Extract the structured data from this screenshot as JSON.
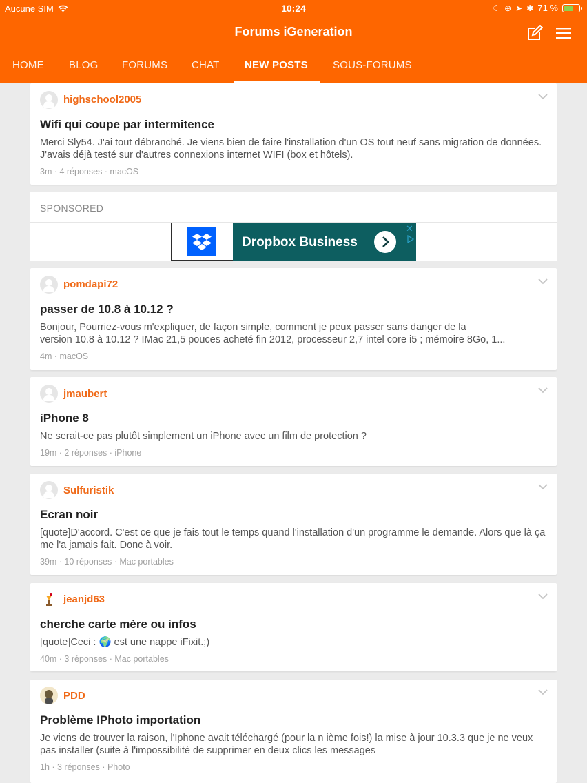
{
  "status_bar": {
    "carrier": "Aucune SIM",
    "time": "10:24",
    "battery": "71 %",
    "battery_level": 0.71
  },
  "header": {
    "title": "Forums iGeneration",
    "compose_icon": "compose-icon",
    "menu_icon": "hamburger-menu-icon",
    "accent_color": "#fe6600"
  },
  "tabs": [
    {
      "label": "HOME"
    },
    {
      "label": "BLOG"
    },
    {
      "label": "FORUMS"
    },
    {
      "label": "CHAT"
    },
    {
      "label": "NEW POSTS",
      "active": true
    },
    {
      "label": "SOUS-FORUMS"
    }
  ],
  "sponsored": {
    "label": "SPONSORED",
    "ad_text": "Dropbox Business",
    "ad_close": "✕"
  },
  "posts": [
    {
      "username": "highschool2005",
      "title": "Wifi qui coupe par intermitence",
      "body": "Merci Sly54.  J'ai tout débranché.  Je viens bien de faire l'installation d'un OS tout neuf sans migration de données. J'avais déjà testé sur d'autres connexions internet WIFI (box et hôtels).",
      "meta": "3m · 4 réponses · macOS"
    },
    {
      "username": "pomdapi72",
      "title": "passer de 10.8 à 10.12 ?",
      "body_line1": "Bonjour, Pourriez-vous m'expliquer, de façon simple, comment je peux passer sans danger de la",
      "body_line2": "version 10.8 à 10.12 ? IMac 21,5 pouces acheté fin 2012, processeur 2,7 intel core i5 ; mémoire 8Go, 1...",
      "meta": "4m · macOS"
    },
    {
      "username": "jmaubert",
      "title": "iPhone 8",
      "body": "Ne serait-ce pas plutôt simplement un iPhone avec un film de protection ?",
      "meta": "19m · 2 réponses · iPhone"
    },
    {
      "username": "Sulfuristik",
      "title": "Ecran noir",
      "body": "[quote]D'accord. C'est ce que je fais tout le temps quand l'installation d'un programme le demande. Alors que là ça me l'a jamais fait. Donc à voir.",
      "meta": "39m · 10 réponses · Mac portables"
    },
    {
      "username": "jeanjd63",
      "title": "cherche carte mère ou infos",
      "body_prefix": "[quote]Ceci : ",
      "body_emoji": "🌍",
      "body_suffix": " est une nappe iFixit.;)",
      "meta": "40m · 3 réponses · Mac portables"
    },
    {
      "username": "PDD",
      "title": "Problème IPhoto importation",
      "body": "Je viens de trouver la raison, l'Iphone avait téléchargé (pour la n ième fois!) la mise à jour 10.3.3 que je ne veux pas installer (suite à l'impossibilité de supprimer en deux clics les messages",
      "meta": "1h · 3 réponses · Photo"
    }
  ]
}
